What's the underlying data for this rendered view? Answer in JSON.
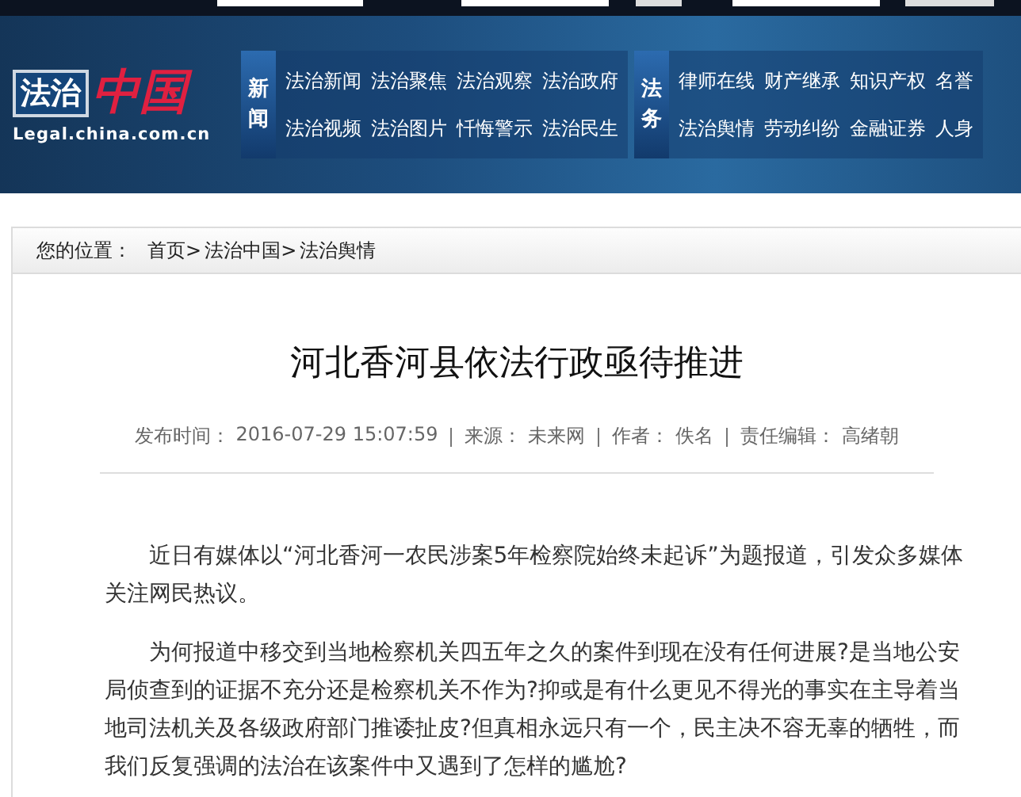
{
  "logo": {
    "badge": "法治",
    "mark": "中国",
    "url": "Legal.china.com.cn"
  },
  "nav_groups": [
    {
      "label": "新闻",
      "rows": [
        [
          "法治新闻",
          "法治聚焦",
          "法治观察",
          "法治政府"
        ],
        [
          "法治视频",
          "法治图片",
          "忏悔警示",
          "法治民生"
        ]
      ]
    },
    {
      "label": "法务",
      "rows": [
        [
          "律师在线",
          "财产继承",
          "知识产权",
          "名誉"
        ],
        [
          "法治舆情",
          "劳动纠纷",
          "金融证券",
          "人身"
        ]
      ]
    }
  ],
  "breadcrumb": {
    "label": "您的位置：",
    "items": [
      "首页>",
      "法治中国>",
      "法治舆情"
    ]
  },
  "article": {
    "title": "河北香河县依法行政亟待推进",
    "meta": [
      {
        "label": "发布时间：",
        "value": "2016-07-29 15:07:59"
      },
      {
        "label": "来源：",
        "value": "未来网"
      },
      {
        "label": "作者：",
        "value": "佚名"
      },
      {
        "label": "责任编辑：",
        "value": "高绪朝"
      }
    ],
    "paragraphs": [
      "近日有媒体以“河北香河一农民涉案5年检察院始终未起诉”为题报道，引发众多媒体关注网民热议。",
      "为何报道中移交到当地检察机关四五年之久的案件到现在没有任何进展?是当地公安局侦查到的证据不充分还是检察机关不作为?抑或是有什么更见不得光的事实在主导着当地司法机关及各级政府部门推诿扯皮?但真相永远只有一个，民主决不容无辜的牺牲，而我们反复强调的法治在该案件中又遇到了怎样的尴尬?"
    ]
  }
}
